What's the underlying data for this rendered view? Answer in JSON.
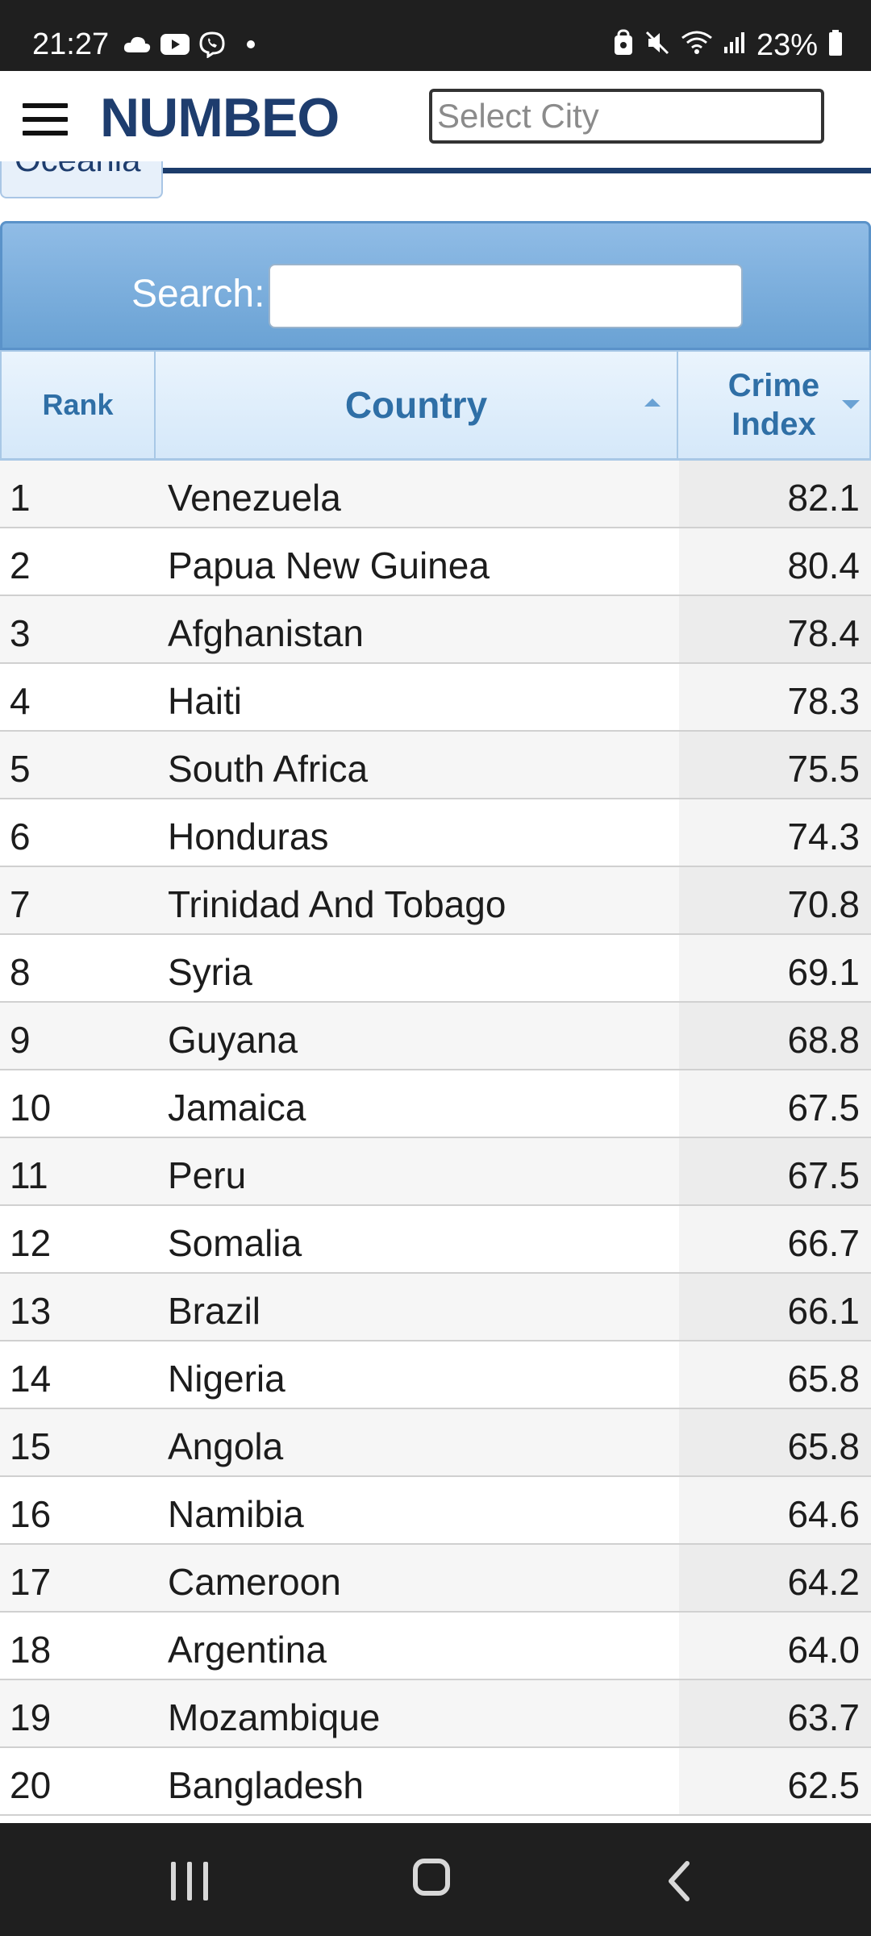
{
  "status_bar": {
    "time": "21:27",
    "battery": "23%",
    "icons_left": [
      "cloud-icon",
      "youtube-icon",
      "viber-icon",
      "dot-icon"
    ],
    "icons_right": [
      "lock-badge-icon",
      "mute-icon",
      "wifi-icon",
      "signal-icon",
      "battery-icon"
    ]
  },
  "header": {
    "menu_icon": "hamburger-icon",
    "logo": "NUMBEO",
    "city_placeholder": "Select City"
  },
  "region_tab": {
    "label": "Oceania"
  },
  "search": {
    "label": "Search:",
    "value": ""
  },
  "table": {
    "columns": {
      "rank": "Rank",
      "country": "Country",
      "crime_index_line1": "Crime",
      "crime_index_line2": "Index"
    },
    "rows": [
      {
        "rank": "1",
        "country": "Venezuela",
        "crime_index": "82.1"
      },
      {
        "rank": "2",
        "country": "Papua New Guinea",
        "crime_index": "80.4"
      },
      {
        "rank": "3",
        "country": "Afghanistan",
        "crime_index": "78.4"
      },
      {
        "rank": "4",
        "country": "Haiti",
        "crime_index": "78.3"
      },
      {
        "rank": "5",
        "country": "South Africa",
        "crime_index": "75.5"
      },
      {
        "rank": "6",
        "country": "Honduras",
        "crime_index": "74.3"
      },
      {
        "rank": "7",
        "country": "Trinidad And Tobago",
        "crime_index": "70.8"
      },
      {
        "rank": "8",
        "country": "Syria",
        "crime_index": "69.1"
      },
      {
        "rank": "9",
        "country": "Guyana",
        "crime_index": "68.8"
      },
      {
        "rank": "10",
        "country": "Jamaica",
        "crime_index": "67.5"
      },
      {
        "rank": "11",
        "country": "Peru",
        "crime_index": "67.5"
      },
      {
        "rank": "12",
        "country": "Somalia",
        "crime_index": "66.7"
      },
      {
        "rank": "13",
        "country": "Brazil",
        "crime_index": "66.1"
      },
      {
        "rank": "14",
        "country": "Nigeria",
        "crime_index": "65.8"
      },
      {
        "rank": "15",
        "country": "Angola",
        "crime_index": "65.8"
      },
      {
        "rank": "16",
        "country": "Namibia",
        "crime_index": "64.6"
      },
      {
        "rank": "17",
        "country": "Cameroon",
        "crime_index": "64.2"
      },
      {
        "rank": "18",
        "country": "Argentina",
        "crime_index": "64.0"
      },
      {
        "rank": "19",
        "country": "Mozambique",
        "crime_index": "63.7"
      },
      {
        "rank": "20",
        "country": "Bangladesh",
        "crime_index": "62.5"
      }
    ]
  },
  "nav_bar": {
    "buttons": [
      "recents-icon",
      "home-icon",
      "back-icon"
    ]
  },
  "colors": {
    "brand": "#1e3d6e",
    "header_accent": "#2f6fa6",
    "search_panel": "#6aa2d4"
  }
}
